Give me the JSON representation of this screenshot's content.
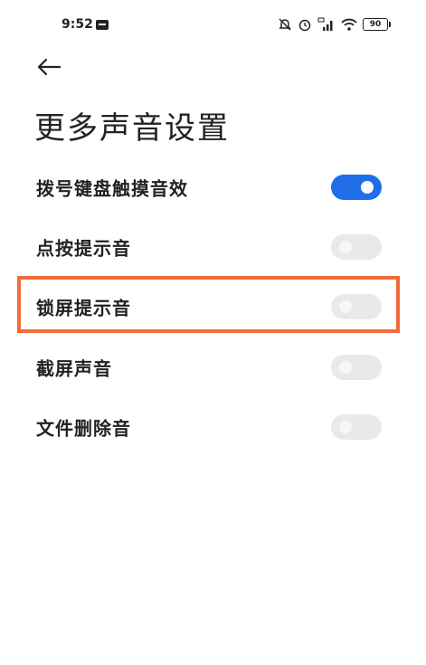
{
  "status_bar": {
    "time": "9:52",
    "battery": "90",
    "icons": [
      "notifications-off-icon",
      "alarm-icon",
      "hd-signal-icon",
      "wifi-icon",
      "battery-icon"
    ]
  },
  "header": {
    "back_icon": "arrow-left-icon",
    "title": "更多声音设置"
  },
  "settings": [
    {
      "label": "拨号键盘触摸音效",
      "enabled": true
    },
    {
      "label": "点按提示音",
      "enabled": false
    },
    {
      "label": "锁屏提示音",
      "enabled": false
    },
    {
      "label": "截屏声音",
      "enabled": false
    },
    {
      "label": "文件删除音",
      "enabled": false
    }
  ],
  "colors": {
    "accent": "#1f6ee8",
    "toggle_off": "#e9e9e9",
    "highlight": "#f26b3a"
  }
}
